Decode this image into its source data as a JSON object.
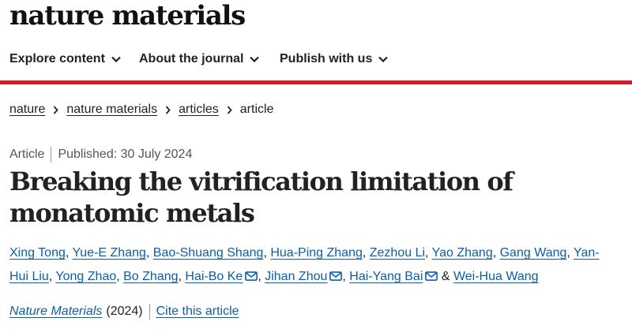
{
  "header": {
    "brand": "nature materials"
  },
  "nav": [
    {
      "label": "Explore content"
    },
    {
      "label": "About the journal"
    },
    {
      "label": "Publish with us"
    }
  ],
  "breadcrumb": [
    "nature",
    "nature materials",
    "articles",
    "article"
  ],
  "meta": {
    "type": "Article",
    "published": "Published: 30 July 2024"
  },
  "article": {
    "title": "Breaking the vitrification limitation of monatomic metals"
  },
  "authors": [
    {
      "name": "Xing Tong"
    },
    {
      "name": "Yue-E Zhang"
    },
    {
      "name": "Bao-Shuang Shang"
    },
    {
      "name": "Hua-Ping Zhang"
    },
    {
      "name": "Zezhou Li"
    },
    {
      "name": "Yao Zhang"
    },
    {
      "name": "Gang Wang"
    },
    {
      "name": "Yan-Hui Liu"
    },
    {
      "name": "Yong Zhao"
    },
    {
      "name": "Bo Zhang"
    },
    {
      "name": "Hai-Bo Ke"
    },
    {
      "name": "Jihan Zhou"
    },
    {
      "name": "Hai-Yang Bai"
    },
    {
      "name": "Wei-Hua Wang"
    }
  ],
  "author_text": {
    "and": "&"
  },
  "citation": {
    "journal": "Nature Materials",
    "year": "(2024)",
    "cite_link": "Cite this article"
  },
  "colors": {
    "accent_red": "#e0162b",
    "link_blue": "#0a5fa8",
    "text": "#222222"
  },
  "icons": {
    "nav_chevron": "chevron-down-icon",
    "crumb_sep": "chevron-right-icon",
    "corresponding": "envelope-icon"
  }
}
